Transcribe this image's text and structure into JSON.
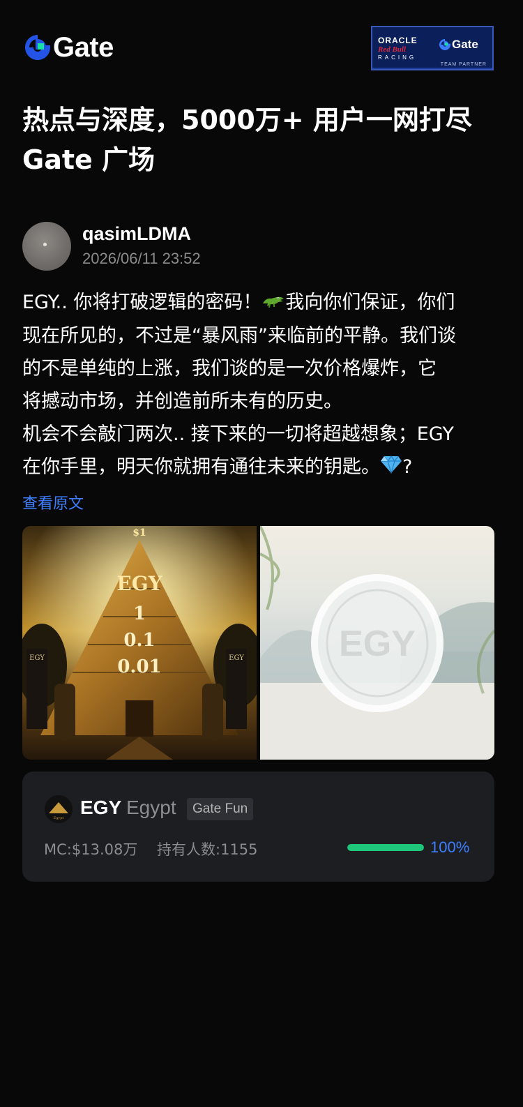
{
  "header": {
    "logo_text": "Gate",
    "brand_color": "#2354e6",
    "partner": {
      "oracle": "ORACLE",
      "redbull": "Red Bull",
      "racing": "RACING",
      "gate": "Gate",
      "team": "TEAM PARTNER"
    }
  },
  "headline": {
    "line1": "热点与深度，5000万+ 用户一网打尽",
    "line2": "Gate 广场"
  },
  "post": {
    "username": "qasimLDMA",
    "timestamp": "2026/06/11 23:52",
    "lines": {
      "l1a": "EGY.. 你将打破逻辑的密码！",
      "l1b": "我向你们保证，你们",
      "l2": "现在所见的，不过是“暴风雨”来临前的平静。我们谈",
      "l3": "的不是单纯的上涨，我们谈的是一次价格爆炸，它",
      "l4": "将撼动市场，并创造前所未有的历史。",
      "l5": "机会不会敲门两次.. 接下来的一切将超越想象；EGY",
      "l6a": "在你手里，明天你就拥有通往未来的钥匙。",
      "l6b": "?"
    },
    "emojis": [
      "crocodile-emoji",
      "gem-emoji"
    ],
    "view_original": "查看原文",
    "images": {
      "pyramid": {
        "top": "$1",
        "egy": "EGY",
        "v1": "1",
        "v2": "0.1",
        "v3": "0.01",
        "banner": "EGY"
      },
      "coin": {
        "text": "EGY"
      }
    }
  },
  "token": {
    "symbol": "EGY",
    "name": "Egypt",
    "badge": "Gate Fun",
    "market_cap": "MC:$13.08万",
    "holders": "持有人数:1155",
    "progress_fraction": 1.0,
    "progress_label": "100%",
    "progress_color": "#1ec77a",
    "icon_caption": "Egypt"
  }
}
